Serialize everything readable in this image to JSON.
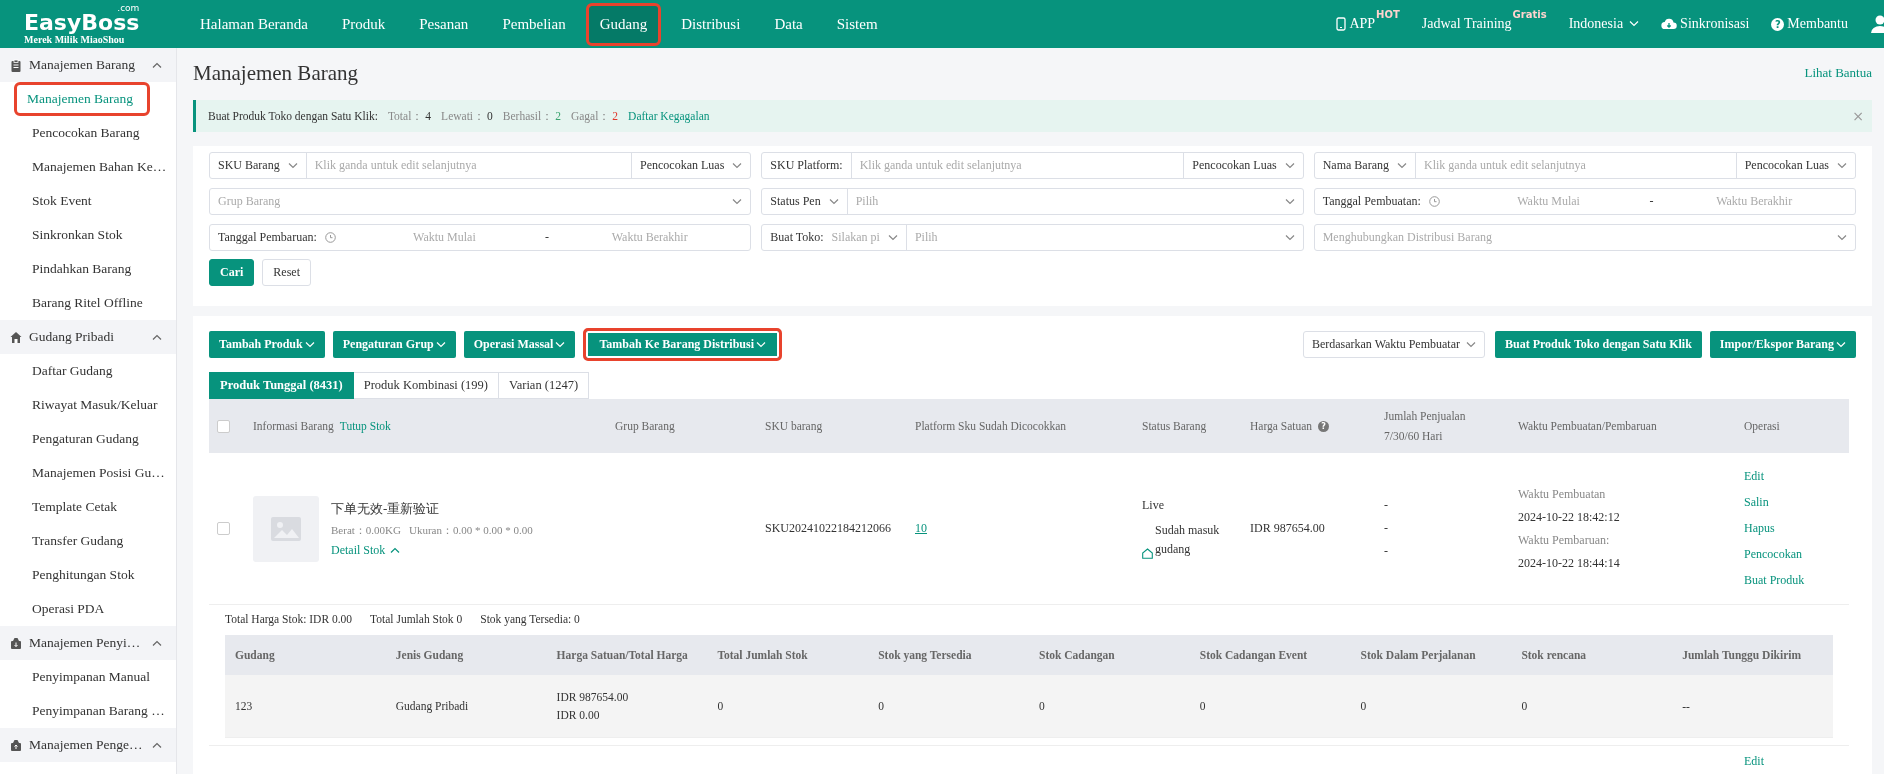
{
  "header": {
    "logo": {
      "name": "EasyBoss",
      "suffix": ".com",
      "tagline": "Merek Milik MiaoShou"
    },
    "nav": [
      {
        "label": "Halaman Beranda",
        "selected": false,
        "highlighted": false
      },
      {
        "label": "Produk",
        "selected": false,
        "highlighted": false
      },
      {
        "label": "Pesanan",
        "selected": false,
        "highlighted": false
      },
      {
        "label": "Pembelian",
        "selected": false,
        "highlighted": false
      },
      {
        "label": "Gudang",
        "selected": true,
        "highlighted": true
      },
      {
        "label": "Distribusi",
        "selected": false,
        "highlighted": false
      },
      {
        "label": "Data",
        "selected": false,
        "highlighted": false
      },
      {
        "label": "Sistem",
        "selected": false,
        "highlighted": false
      }
    ],
    "tools": [
      {
        "kind": "app",
        "label": "APP",
        "badge": "HOT"
      },
      {
        "kind": "training",
        "label": "Jadwal Training",
        "badge": "Gratis"
      },
      {
        "kind": "language",
        "label": "Indonesia"
      },
      {
        "kind": "sync",
        "label": "Sinkronisasi"
      },
      {
        "kind": "help",
        "label": "Membantu",
        "icon": "?"
      },
      {
        "kind": "user"
      }
    ]
  },
  "sidebar": {
    "groups": [
      {
        "kind": "clipboard",
        "label": "Manajemen Barang",
        "expanded": true,
        "items": [
          {
            "label": "Manajemen Barang",
            "selected": true,
            "highlighted": true
          },
          {
            "label": "Pencocokan Barang",
            "selected": false,
            "highlighted": false
          },
          {
            "label": "Manajemen Bahan Ke…",
            "selected": false,
            "highlighted": false
          },
          {
            "label": "Stok Event",
            "selected": false,
            "highlighted": false
          },
          {
            "label": "Sinkronkan Stok",
            "selected": false,
            "highlighted": false
          },
          {
            "label": "Pindahkan Barang",
            "selected": false,
            "highlighted": false
          },
          {
            "label": "Barang Ritel Offline",
            "selected": false,
            "highlighted": false
          }
        ]
      },
      {
        "kind": "house",
        "label": "Gudang Pribadi",
        "expanded": true,
        "items": [
          {
            "label": "Daftar Gudang",
            "selected": false,
            "highlighted": false
          },
          {
            "label": "Riwayat Masuk/Keluar",
            "selected": false,
            "highlighted": false
          },
          {
            "label": "Pengaturan Gudang",
            "selected": false,
            "highlighted": false
          },
          {
            "label": "Manajemen Posisi Gu…",
            "selected": false,
            "highlighted": false
          },
          {
            "label": "Template Cetak",
            "selected": false,
            "highlighted": false
          },
          {
            "label": "Transfer Gudang",
            "selected": false,
            "highlighted": false
          },
          {
            "label": "Penghitungan Stok",
            "selected": false,
            "highlighted": false
          },
          {
            "label": "Operasi PDA",
            "selected": false,
            "highlighted": false
          }
        ]
      },
      {
        "kind": "box-in",
        "label": "Manajemen Penyi…",
        "expanded": true,
        "items": [
          {
            "label": "Penyimpanan Manual",
            "selected": false,
            "highlighted": false
          },
          {
            "label": "Penyimpanan Barang …",
            "selected": false,
            "highlighted": false
          }
        ]
      },
      {
        "kind": "box-out",
        "label": "Manajemen Penge…",
        "expanded": true
      }
    ]
  },
  "page": {
    "title": "Manajemen Barang",
    "help_link": "Lihat Bantua"
  },
  "notice": {
    "label": "Buat Produk Toko dengan Satu Klik:",
    "stats": [
      {
        "label": "Total：",
        "value": "4",
        "kind": "neutral"
      },
      {
        "label": "Lewati：",
        "value": "0",
        "kind": "neutral"
      },
      {
        "label": "Berhasil：",
        "value": "2",
        "kind": "success"
      },
      {
        "label": "Gagal：",
        "value": "2",
        "kind": "error"
      }
    ],
    "link": "Daftar Kegagalan",
    "close": "×"
  },
  "filters": {
    "fields": [
      {
        "kind": "search",
        "label": "SKU Barang",
        "label_dropdown": true,
        "placeholder": "Klik ganda untuk edit selanjutnya",
        "match": "Pencocokan Luas"
      },
      {
        "kind": "search",
        "label": "SKU Platform:",
        "label_dropdown": false,
        "placeholder": "Klik ganda untuk edit selanjutnya",
        "match": "Pencocokan Luas"
      },
      {
        "kind": "search",
        "label": "Nama Barang",
        "label_dropdown": true,
        "placeholder": "Klik ganda untuk edit selanjutnya",
        "match": "Pencocokan Luas"
      },
      {
        "kind": "dropdown",
        "placeholder": "Grup Barang"
      },
      {
        "kind": "double",
        "first": "Status Pen",
        "placeholder": "Pilih"
      },
      {
        "kind": "daterange",
        "label": "Tanggal Pembuatan:",
        "start": "Waktu Mulai",
        "separator": "-",
        "end": "Waktu Berakhir"
      },
      {
        "kind": "daterange",
        "label": "Tanggal Pembaruan:",
        "start": "Waktu Mulai",
        "separator": "-",
        "end": "Waktu Berakhir"
      },
      {
        "kind": "double",
        "label": "Buat Toko:",
        "first": "Silakan pi",
        "placeholder": "Pilih"
      },
      {
        "kind": "dropdown",
        "placeholder": "Menghubungkan Distribusi Barang"
      }
    ],
    "buttons": [
      {
        "label": "Cari",
        "kind": "primary"
      },
      {
        "label": "Reset",
        "kind": "default"
      }
    ]
  },
  "products": {
    "actions": [
      {
        "label": "Tambah Produk",
        "dropdown": true,
        "highlighted": false
      },
      {
        "label": "Pengaturan Grup",
        "dropdown": true,
        "highlighted": false
      },
      {
        "label": "Operasi Massal",
        "dropdown": true,
        "highlighted": false
      },
      {
        "label": "Tambah Ke Barang Distribusi",
        "dropdown": true,
        "highlighted": true
      }
    ],
    "sort": "Berdasarkan Waktu Pembuatar",
    "right_actions": [
      {
        "label": "Buat Produk Toko dengan Satu Klik",
        "dropdown": false
      },
      {
        "label": "Impor/Ekspor Barang",
        "dropdown": true
      }
    ],
    "tabs": [
      {
        "label": "Produk Tunggal (8431)",
        "selected": true
      },
      {
        "label": "Produk Kombinasi (199)",
        "selected": false
      },
      {
        "label": "Varian (1247)",
        "selected": false
      }
    ],
    "table": {
      "select_all": false,
      "columns": [
        {
          "label": "Informasi Barang",
          "link": "Tutup Stok"
        },
        {
          "label": "Grup Barang"
        },
        {
          "label": "SKU barang"
        },
        {
          "label": "Platform Sku Sudah Dicocokkan"
        },
        {
          "label": "Status Barang"
        },
        {
          "label": "Harga Satuan",
          "help_icon": "?"
        },
        {
          "label": "Jumlah Penjualan 7/30/60 Hari"
        },
        {
          "label": "Waktu Pembuatan/Pembaruan"
        },
        {
          "label": "Operasi"
        }
      ],
      "rows": [
        {
          "checked": false,
          "name": "下单无效-重新验证",
          "weight": "Berat：0.00KG",
          "size": "Ukuran：0.00 * 0.00 * 0.00",
          "detail_link": "Detail Stok",
          "detail_expanded": true,
          "sku": "SKU20241022184212066",
          "platform_matched": "10",
          "status": "Live",
          "warehouse_status": "Sudah masuk gudang",
          "price": "IDR 987654.00",
          "sales": [
            "-",
            "-",
            "-"
          ],
          "created_label": "Waktu Pembuatan",
          "created": "2024-10-22 18:42:12",
          "updated_label": "Waktu Pembaruan:",
          "updated": "2024-10-22 18:44:14",
          "operations": [
            "Edit",
            "Salin",
            "Hapus",
            "Pencocokan",
            "Buat Produk"
          ],
          "stock_summary": [
            "Total Harga Stok: IDR 0.00",
            "Total Jumlah Stok 0",
            "Stok yang Tersedia: 0"
          ],
          "stock_columns": [
            "Gudang",
            "Jenis Gudang",
            "Harga Satuan/Total Harga",
            "Total Jumlah Stok",
            "Stok yang Tersedia",
            "Stok Cadangan",
            "Stok Cadangan Event",
            "Stok Dalam Perjalanan",
            "Stok rencana",
            "Jumlah Tunggu Dikirim"
          ],
          "stock_rows": [
            {
              "cells": [
                "123",
                "Gudang Pribadi",
                [
                  "IDR 987654.00",
                  "IDR 0.00"
                ],
                "0",
                "0",
                "0",
                "0",
                "0",
                "0",
                "--"
              ]
            }
          ]
        },
        {
          "operations": [
            "Edit"
          ]
        }
      ]
    }
  }
}
